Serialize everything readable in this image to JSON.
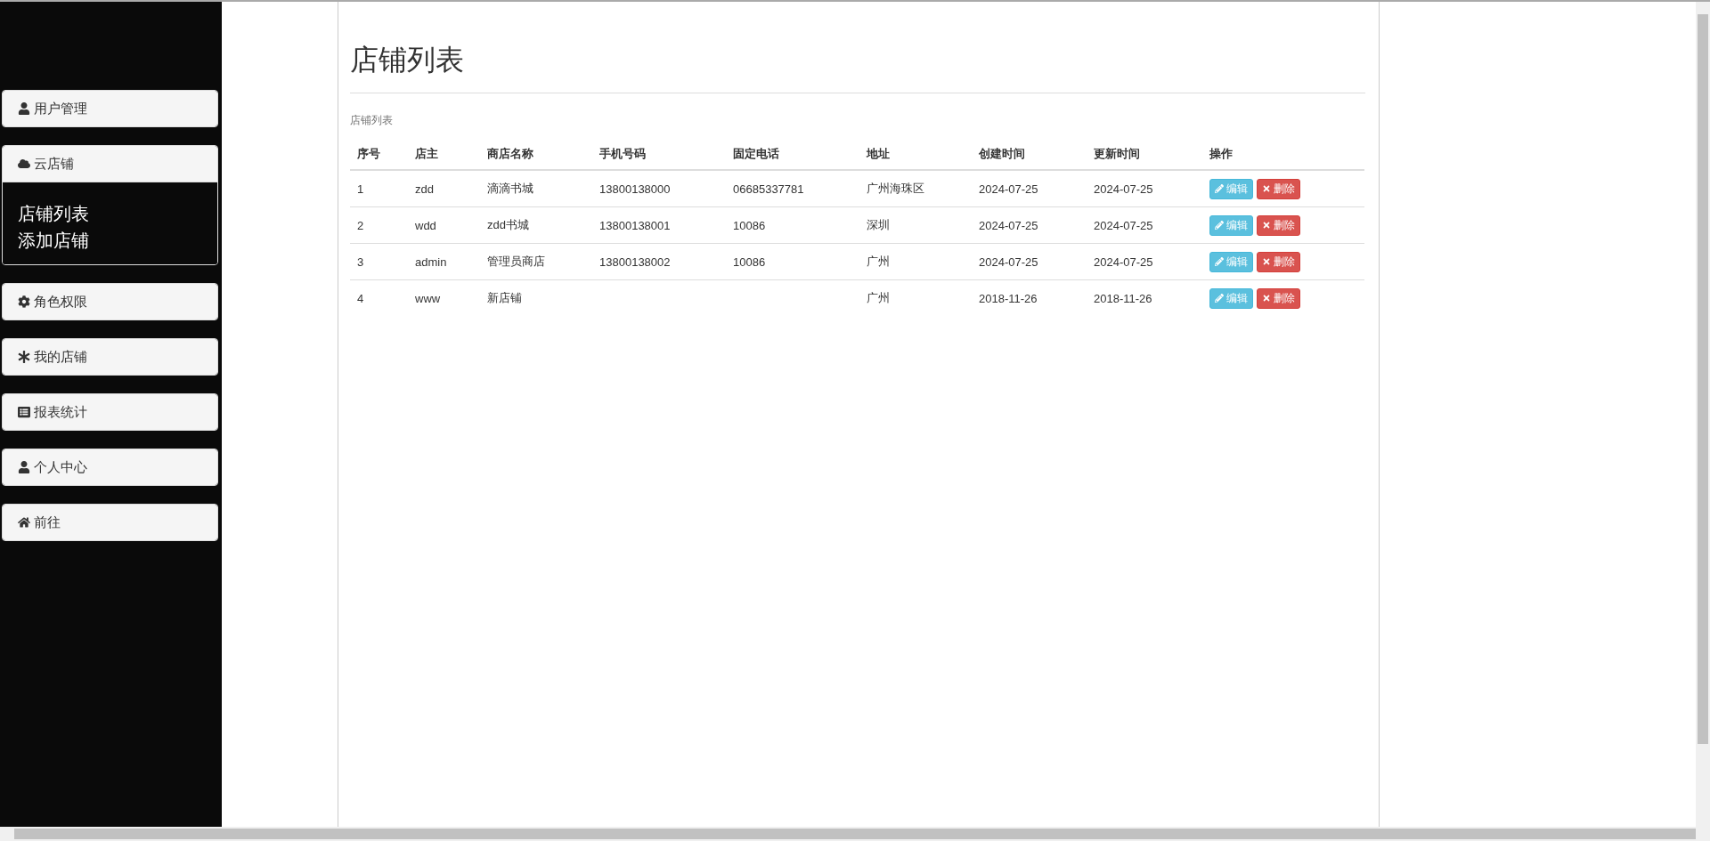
{
  "sidebar": {
    "items": [
      {
        "label": "用户管理",
        "expanded": false
      },
      {
        "label": "云店铺",
        "expanded": true,
        "children": [
          {
            "label": "店铺列表"
          },
          {
            "label": "添加店铺"
          }
        ]
      },
      {
        "label": "角色权限",
        "expanded": false
      },
      {
        "label": "我的店铺",
        "expanded": false
      },
      {
        "label": "报表统计",
        "expanded": false
      },
      {
        "label": "个人中心",
        "expanded": false
      },
      {
        "label": "前往",
        "expanded": false
      }
    ]
  },
  "page": {
    "title": "店铺列表",
    "caption": "店铺列表"
  },
  "table": {
    "columns": [
      "序号",
      "店主",
      "商店名称",
      "手机号码",
      "固定电话",
      "地址",
      "创建时间",
      "更新时间",
      "操作"
    ],
    "rows": [
      {
        "cells": [
          "1",
          "zdd",
          "滴滴书城",
          "13800138000",
          "06685337781",
          "广州海珠区",
          "2024-07-25",
          "2024-07-25"
        ],
        "actions": [
          {
            "kind": "edit",
            "label": "编辑"
          },
          {
            "kind": "delete",
            "label": "删除"
          }
        ]
      },
      {
        "cells": [
          "2",
          "wdd",
          "zdd书城",
          "13800138001",
          "10086",
          "深圳",
          "2024-07-25",
          "2024-07-25"
        ],
        "actions": [
          {
            "kind": "edit",
            "label": "编辑"
          },
          {
            "kind": "delete",
            "label": "删除"
          }
        ]
      },
      {
        "cells": [
          "3",
          "admin",
          "管理员商店",
          "13800138002",
          "10086",
          "广州",
          "2024-07-25",
          "2024-07-25"
        ],
        "actions": [
          {
            "kind": "edit",
            "label": "编辑"
          },
          {
            "kind": "delete",
            "label": "删除"
          }
        ]
      },
      {
        "cells": [
          "4",
          "www",
          "新店铺",
          "",
          "",
          "广州",
          "2018-11-26",
          "2018-11-26"
        ],
        "actions": [
          {
            "kind": "edit",
            "label": "编辑"
          },
          {
            "kind": "delete",
            "label": "删除"
          }
        ]
      }
    ]
  }
}
